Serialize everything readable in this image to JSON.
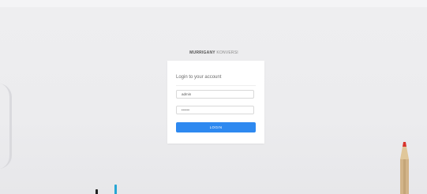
{
  "brand": {
    "bold": "MURRIGANY",
    "light": "KONVERSI"
  },
  "login": {
    "heading": "Login to your account",
    "username_value": "admin",
    "password_value": "•••••",
    "submit_label": "LOGIN"
  },
  "colors": {
    "accent": "#2e89f0",
    "background": "#ececee",
    "card": "#ffffff"
  }
}
